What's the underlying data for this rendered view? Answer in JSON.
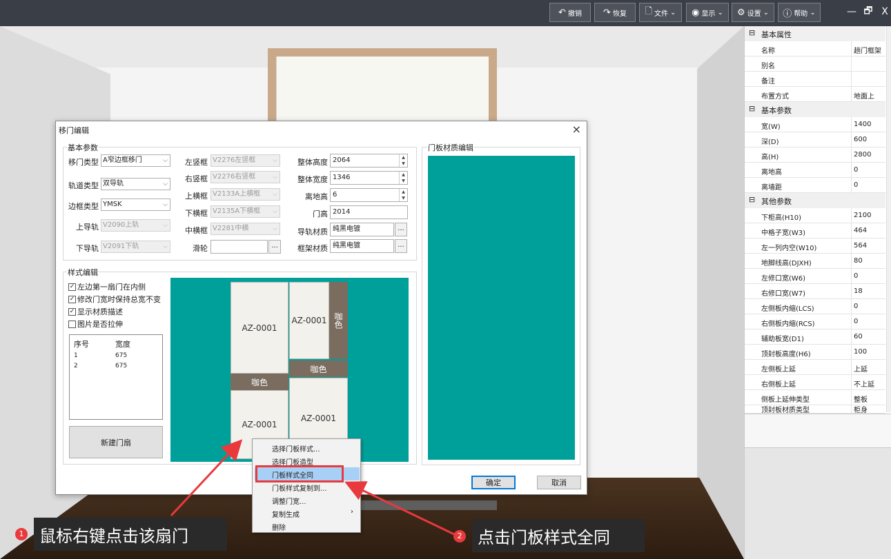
{
  "toolbar": {
    "undo": "撤销",
    "redo": "恢复",
    "file": "文件",
    "view": "显示",
    "settings": "设置",
    "help": "帮助",
    "win_min": "—",
    "win_restore": "🗗",
    "win_close": "X"
  },
  "dialog": {
    "title": "移门编辑",
    "basic_params": {
      "group_title": "基本参数",
      "door_type_label": "移门类型",
      "door_type": "A窄边框移门",
      "track_type_label": "轨道类型",
      "track_type": "双导轨",
      "frame_type_label": "边框类型",
      "frame_type": "YMSK",
      "upper_rail_label": "上导轨",
      "upper_rail": "V2090上轨",
      "lower_rail_label": "下导轨",
      "lower_rail": "V2091下轨",
      "left_frame_label": "左竖框",
      "left_frame": "V2276左竖框",
      "right_frame_label": "右竖框",
      "right_frame": "V2276右竖框",
      "top_frame_label": "上横框",
      "top_frame": "V2133A上横框",
      "bottom_frame_label": "下横框",
      "bottom_frame": "V2135A下横框",
      "mid_frame_label": "中横框",
      "mid_frame": "V2281中横",
      "pulley_label": "滑轮",
      "pulley": "",
      "total_height_label": "整体高度",
      "total_height": "2064",
      "total_width_label": "整体宽度",
      "total_width": "1346",
      "floor_height_label": "离地高",
      "floor_height": "6",
      "door_height_label": "门高",
      "door_height": "2014",
      "rail_material_label": "导轨材质",
      "rail_material": "纯黑电镀",
      "frame_material_label": "框架材质",
      "frame_material": "纯黑电镀",
      "browse": "..."
    },
    "style_edit": {
      "group_title": "样式编辑",
      "checks": [
        {
          "label": "左边第一扇门在内侧",
          "checked": true
        },
        {
          "label": "修改门宽时保持总宽不变",
          "checked": true
        },
        {
          "label": "显示材质描述",
          "checked": true
        },
        {
          "label": "图片是否拉伸",
          "checked": false
        }
      ],
      "list_headers": [
        "序号",
        "宽度"
      ],
      "list_rows": [
        [
          "1",
          "675"
        ],
        [
          "2",
          "675"
        ]
      ],
      "new_door_button": "新建门扇"
    },
    "door_preview": {
      "left_top": "AZ-0001",
      "left_mid": "咖色",
      "left_bottom": "AZ-0001",
      "right_top": "AZ-0001",
      "right_side": "咖色",
      "right_mid": "咖色",
      "right_bottom": "AZ-0001"
    },
    "material_edit": {
      "group_title": "门板材质编辑"
    },
    "ok_button": "确定",
    "cancel_button": "取消",
    "close_icon": "×"
  },
  "context_menu": {
    "items": [
      "选择门板样式...",
      "选择门板造型",
      "门板样式全同",
      "门板样式复制到...",
      "调整门宽...",
      "复制生成",
      "删除"
    ],
    "submenu_arrow": "›"
  },
  "properties": {
    "categories": [
      {
        "title": "基本属性",
        "rows": [
          [
            "名称",
            "趟门框架"
          ],
          [
            "别名",
            ""
          ],
          [
            "备注",
            ""
          ],
          [
            "布置方式",
            "地面上"
          ]
        ]
      },
      {
        "title": "基本参数",
        "rows": [
          [
            "宽(W)",
            "1400"
          ],
          [
            "深(D)",
            "600"
          ],
          [
            "高(H)",
            "2800"
          ],
          [
            "离地高",
            "0"
          ],
          [
            "离墙距",
            "0"
          ]
        ]
      },
      {
        "title": "其他参数",
        "rows": [
          [
            "下柜高(H10)",
            "2100"
          ],
          [
            "中格子宽(W3)",
            "464"
          ],
          [
            "左一列内空(W10)",
            "564"
          ],
          [
            "地脚线高(DJXH)",
            "80"
          ],
          [
            "左修口宽(W6)",
            "0"
          ],
          [
            "右修口宽(W7)",
            "18"
          ],
          [
            "左侧板内缩(LCS)",
            "0"
          ],
          [
            "右侧板内缩(RCS)",
            "0"
          ],
          [
            "辅助板宽(D1)",
            "60"
          ],
          [
            "顶封板高度(H6)",
            "100"
          ],
          [
            "左侧板上延",
            "上延"
          ],
          [
            "右侧板上延",
            "不上延"
          ],
          [
            "侧板上延伸类型",
            "整板"
          ],
          [
            "顶封板材质类型",
            "柜身"
          ]
        ]
      }
    ],
    "collapse_icon": "⊟"
  },
  "annotations": {
    "step1_num": "1",
    "step1": "鼠标右键点击该扇门",
    "step2_num": "2",
    "step2": "点击门板样式全同"
  }
}
